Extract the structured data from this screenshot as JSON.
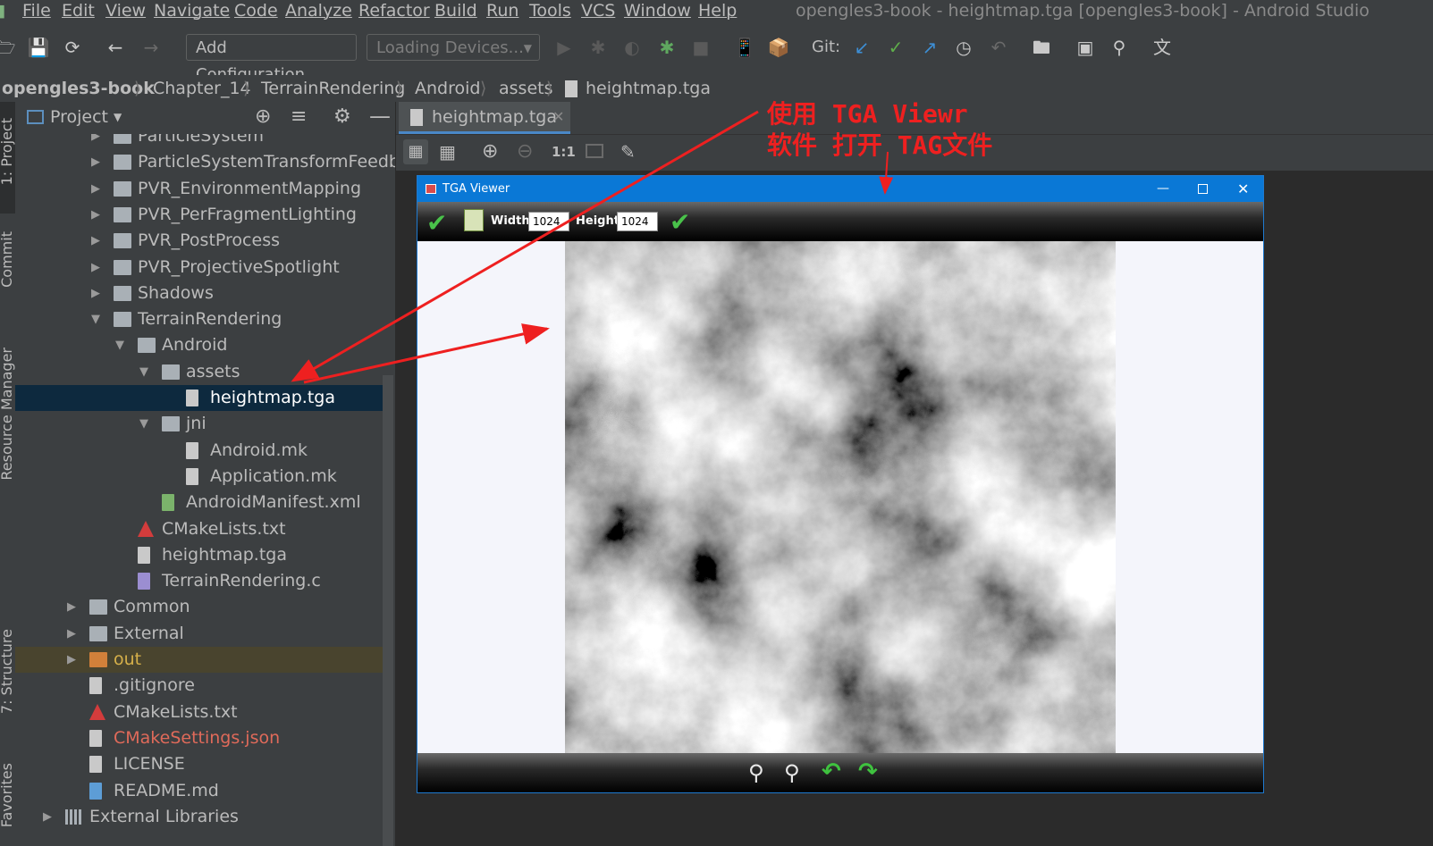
{
  "menu": {
    "items": [
      "File",
      "Edit",
      "View",
      "Navigate",
      "Code",
      "Analyze",
      "Refactor",
      "Build",
      "Run",
      "Tools",
      "VCS",
      "Window",
      "Help"
    ],
    "window_title": "opengles3-book - heightmap.tga [opengles3-book] - Android Studio"
  },
  "toolbar": {
    "add_configuration": "Add Configuration...",
    "devices": "Loading Devices...",
    "git_label": "Git:"
  },
  "breadcrumbs": [
    "opengles3-book",
    "Chapter_14",
    "TerrainRendering",
    "Android",
    "assets",
    "heightmap.tga"
  ],
  "project_panel": {
    "title": "Project",
    "tree": [
      {
        "label": "ParticleSystem",
        "kind": "folder",
        "state": "collapsed"
      },
      {
        "label": "ParticleSystemTransformFeedback",
        "kind": "folder",
        "state": "collapsed"
      },
      {
        "label": "PVR_EnvironmentMapping",
        "kind": "folder",
        "state": "collapsed"
      },
      {
        "label": "PVR_PerFragmentLighting",
        "kind": "folder",
        "state": "collapsed"
      },
      {
        "label": "PVR_PostProcess",
        "kind": "folder",
        "state": "collapsed"
      },
      {
        "label": "PVR_ProjectiveSpotlight",
        "kind": "folder",
        "state": "collapsed"
      },
      {
        "label": "Shadows",
        "kind": "folder",
        "state": "collapsed"
      },
      {
        "label": "TerrainRendering",
        "kind": "folder",
        "state": "expanded"
      },
      {
        "label": "Android",
        "kind": "folder",
        "state": "expanded"
      },
      {
        "label": "assets",
        "kind": "folder",
        "state": "expanded"
      },
      {
        "label": "heightmap.tga",
        "kind": "file",
        "state": "selected"
      },
      {
        "label": "jni",
        "kind": "folder",
        "state": "expanded"
      },
      {
        "label": "Android.mk",
        "kind": "file"
      },
      {
        "label": "Application.mk",
        "kind": "file"
      },
      {
        "label": "AndroidManifest.xml",
        "kind": "manifest"
      },
      {
        "label": "CMakeLists.txt",
        "kind": "cmake"
      },
      {
        "label": "heightmap.tga",
        "kind": "file"
      },
      {
        "label": "TerrainRendering.c",
        "kind": "cfile"
      },
      {
        "label": "Common",
        "kind": "folder",
        "state": "collapsed"
      },
      {
        "label": "External",
        "kind": "folder",
        "state": "collapsed"
      },
      {
        "label": "out",
        "kind": "folder-excluded",
        "state": "collapsed"
      },
      {
        "label": ".gitignore",
        "kind": "file"
      },
      {
        "label": "CMakeLists.txt",
        "kind": "cmake"
      },
      {
        "label": "CMakeSettings.json",
        "kind": "file-modified"
      },
      {
        "label": "LICENSE",
        "kind": "file"
      },
      {
        "label": "README.md",
        "kind": "md"
      },
      {
        "label": "External Libraries",
        "kind": "library",
        "state": "collapsed"
      }
    ]
  },
  "side_tabs": [
    "1: Project",
    "Commit",
    "Resource Manager",
    "7: Structure",
    "Favorites"
  ],
  "editor": {
    "tab_label": "heightmap.tga",
    "zoom_label": "1:1"
  },
  "tga_viewer": {
    "title": "TGA Viewer",
    "width_label": "Width",
    "width_value": "1024",
    "height_label": "Height",
    "height_value": "1024"
  },
  "annotation": {
    "line1": "使用 TGA Viewr",
    "line2": "软件 打开 TAG文件"
  },
  "colors": {
    "ide_bg": "#3c3f41",
    "selection": "#0d293e",
    "excluded_row": "#49442e",
    "excluded_text": "#d6b04a",
    "modified_text": "#e06a5a",
    "annotation_red": "#ee2020",
    "viewer_titlebar": "#0a78d6"
  }
}
